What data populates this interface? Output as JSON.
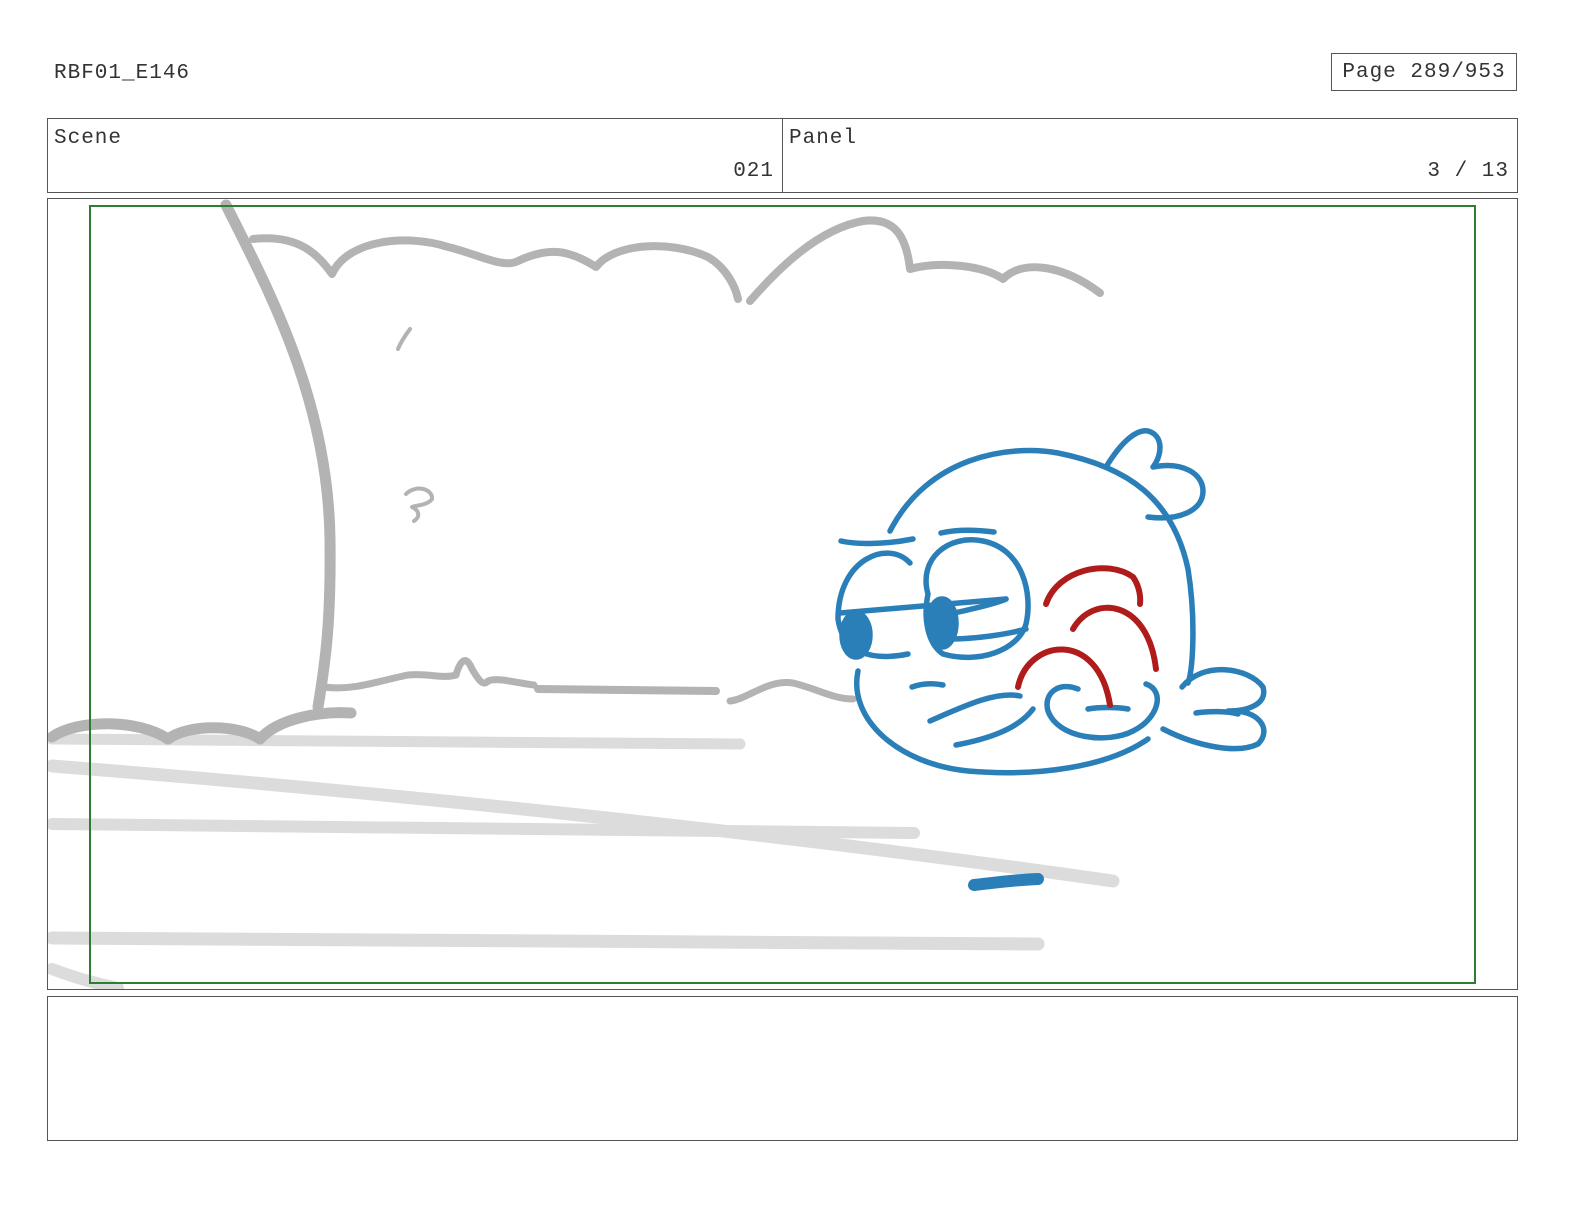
{
  "header": {
    "doc_id": "RBF01_E146",
    "page_label": "Page 289/953"
  },
  "info": {
    "scene_label": "Scene",
    "scene_value": "021",
    "panel_label": "Panel",
    "panel_value": "3 / 13"
  },
  "notes": {
    "text": ""
  },
  "colors": {
    "safe_frame": "#2e7d32",
    "character_line": "#2b7fb8",
    "accent_line": "#b01c1c",
    "background_line": "#b3b3b3"
  }
}
